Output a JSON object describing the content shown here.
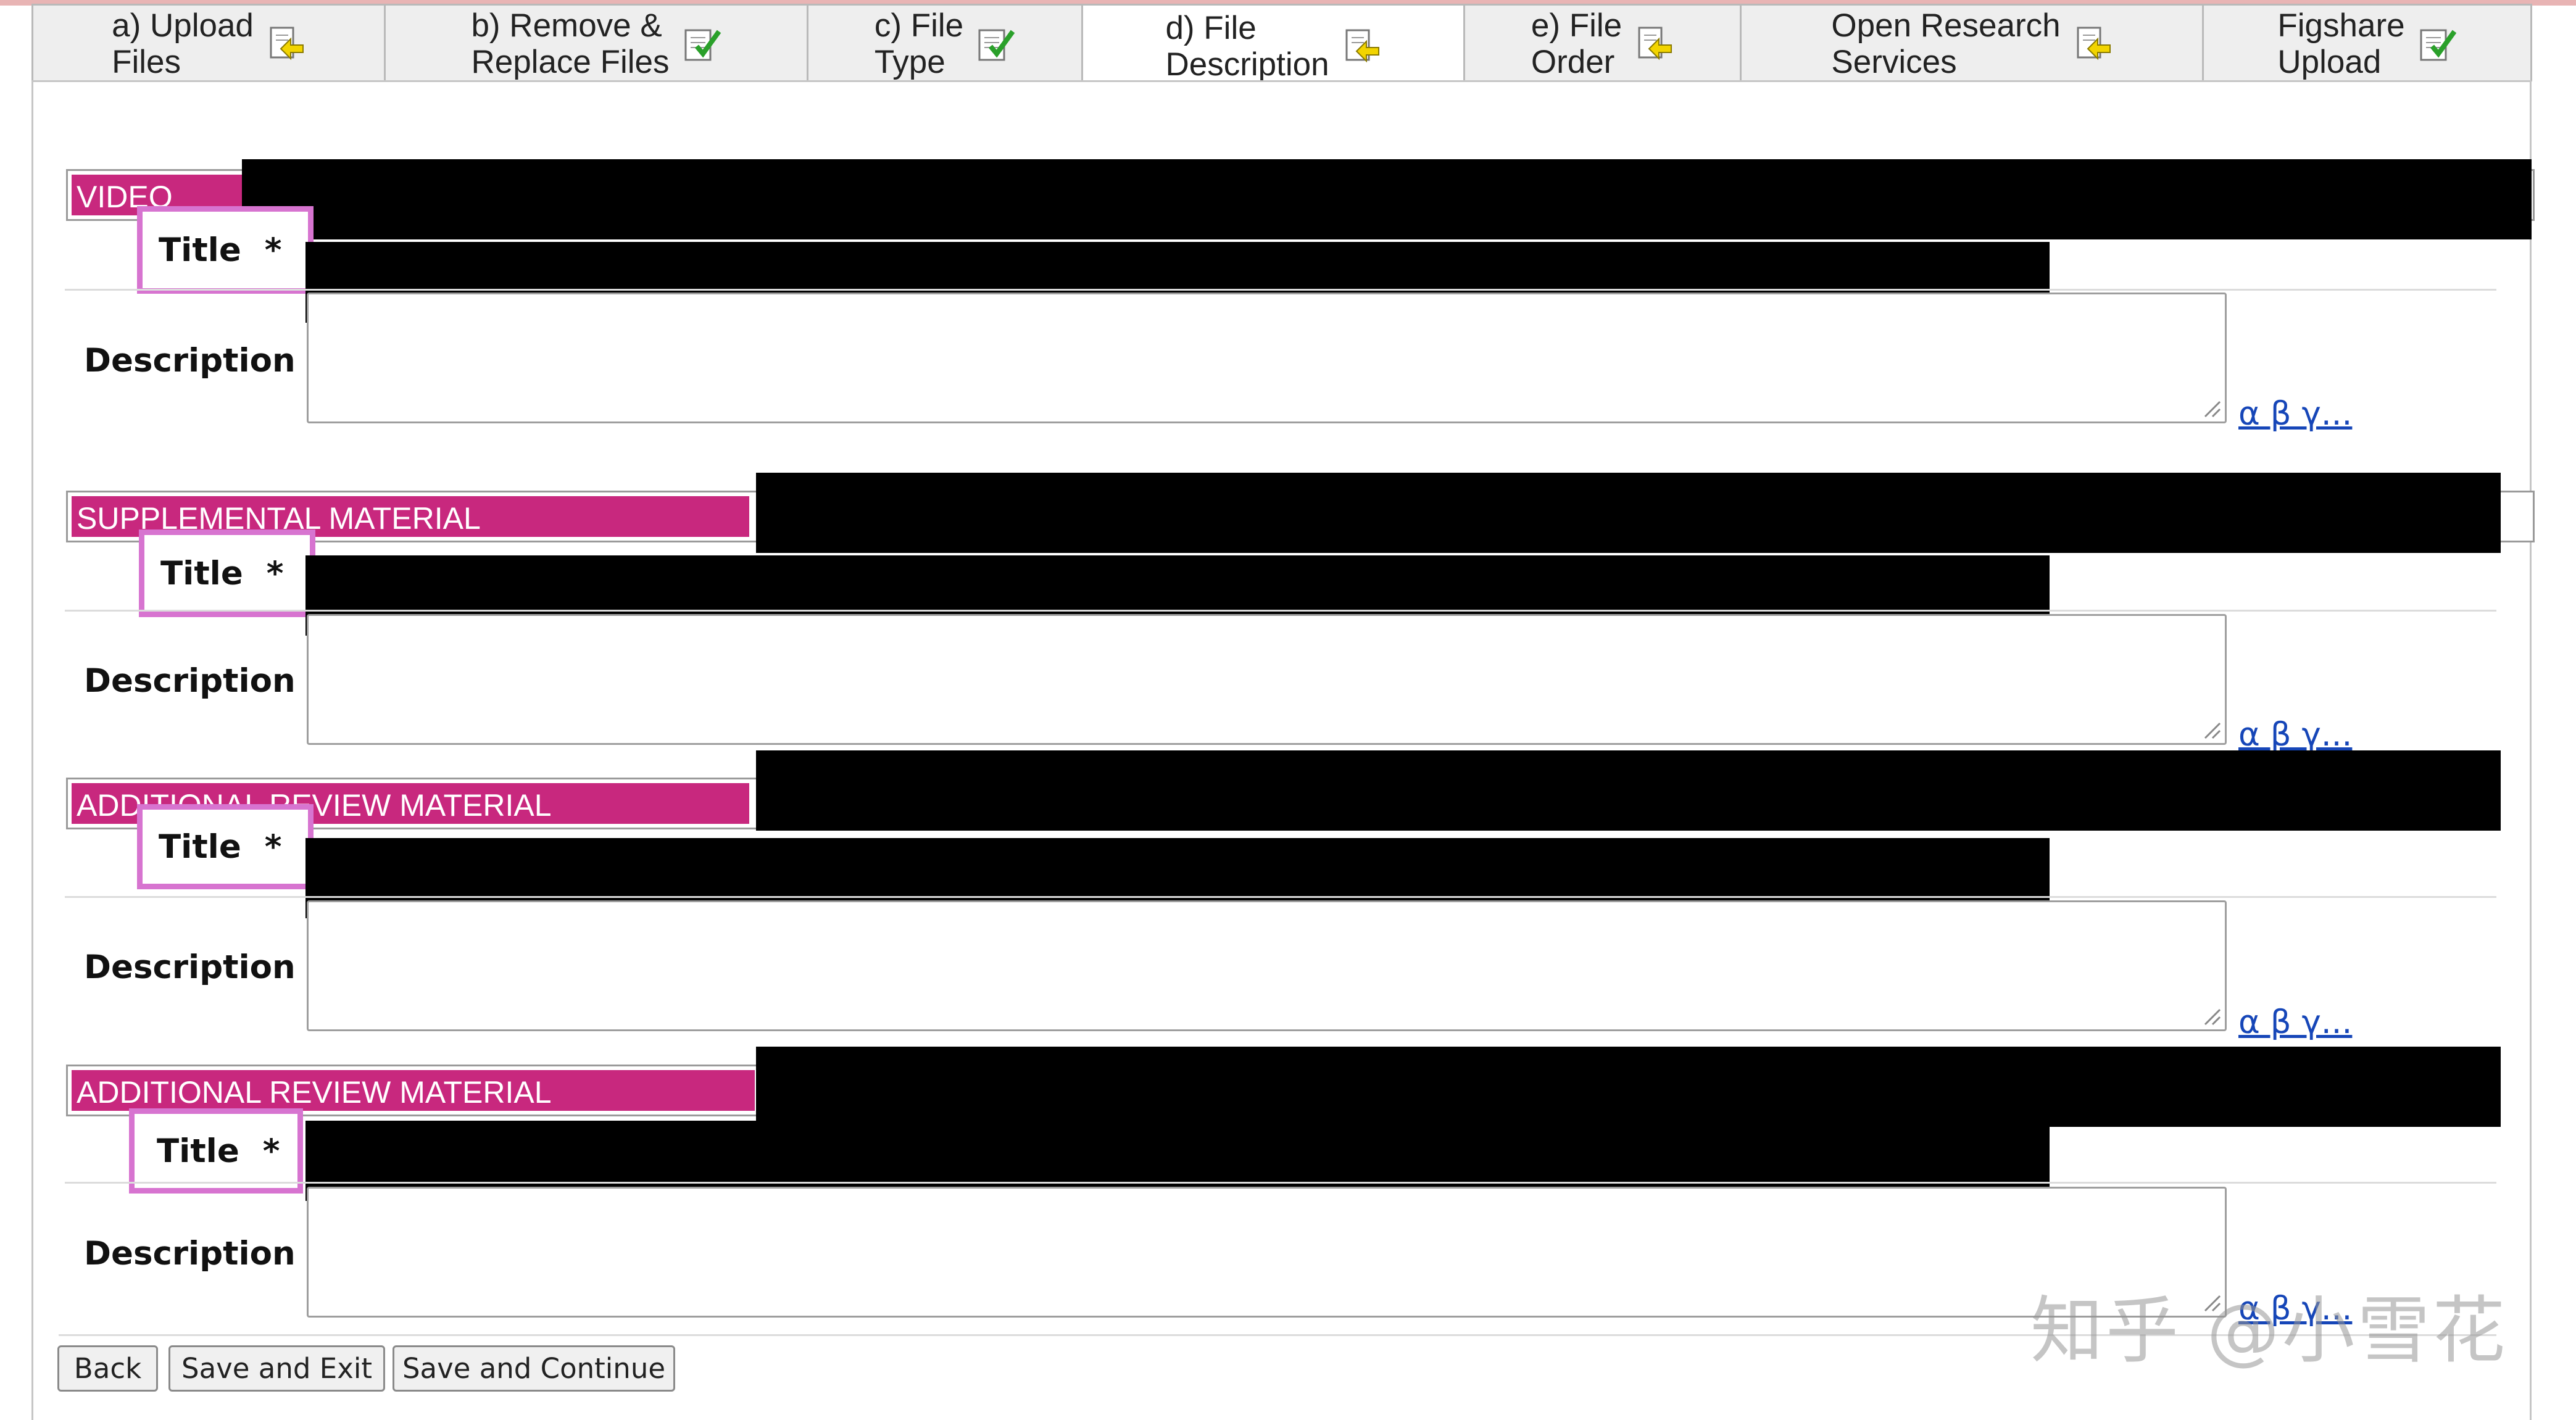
{
  "tabs": [
    {
      "label": "a) Upload\nFiles",
      "icon": "arrow-back-icon"
    },
    {
      "label": "b) Remove &\nReplace Files",
      "icon": "check-doc-icon"
    },
    {
      "label": "c) File\nType",
      "icon": "check-doc-icon"
    },
    {
      "label": "d) File\nDescription",
      "icon": "arrow-back-icon",
      "active": true
    },
    {
      "label": "e) File\nOrder",
      "icon": "arrow-back-icon"
    },
    {
      "label": "Open Research\nServices",
      "icon": "arrow-back-icon"
    },
    {
      "label": "Figshare\nUpload",
      "icon": "check-doc-icon"
    }
  ],
  "sections": [
    {
      "heading": "VIDEO",
      "title_label": "Title",
      "required_mark": "*",
      "description_label": "Description",
      "greek_link": "α β γ..."
    },
    {
      "heading": "SUPPLEMENTAL MATERIAL",
      "title_label": "Title",
      "required_mark": "*",
      "description_label": "Description",
      "greek_link": "α β γ..."
    },
    {
      "heading": "ADDITIONAL REVIEW MATERIAL",
      "title_label": "Title",
      "required_mark": "*",
      "description_label": "Description",
      "greek_link": "α β γ..."
    },
    {
      "heading": "ADDITIONAL REVIEW MATERIAL",
      "title_label": "Title",
      "required_mark": "*",
      "description_label": "Description",
      "greek_link": "α β γ..."
    }
  ],
  "buttons": {
    "back": "Back",
    "save_exit": "Save and Exit",
    "save_continue": "Save and Continue"
  },
  "watermark": "知乎 @小雪花",
  "colors": {
    "section_band": "#c8287e",
    "highlight_box": "#d774d0",
    "redaction": "#000000",
    "link": "#1646b8"
  }
}
